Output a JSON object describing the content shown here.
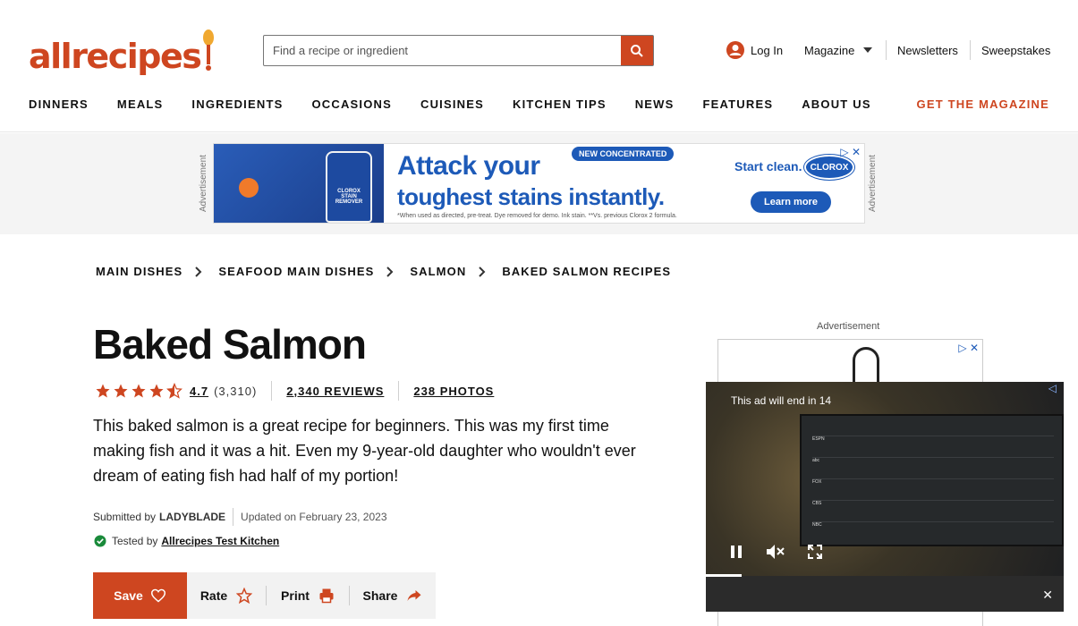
{
  "header": {
    "logo_text": "allrecipes",
    "search_placeholder": "Find a recipe or ingredient",
    "login_label": "Log In",
    "magazine_label": "Magazine",
    "newsletters_label": "Newsletters",
    "sweepstakes_label": "Sweepstakes",
    "brand_color": "#ce4620"
  },
  "nav": {
    "items": [
      "DINNERS",
      "MEALS",
      "INGREDIENTS",
      "OCCASIONS",
      "CUISINES",
      "KITCHEN TIPS",
      "NEWS",
      "FEATURES",
      "ABOUT US"
    ],
    "cta": "GET THE MAGAZINE"
  },
  "top_ad": {
    "label": "Advertisement",
    "headline_line1": "Attack your",
    "headline_line2": "toughest stains instantly.",
    "tag": "NEW CONCENTRATED",
    "start_clean": "Start clean.",
    "brand": "CLOROX",
    "bottle_text": "CLOROX STAIN REMOVER",
    "learn_more": "Learn more",
    "fine_print": "*When used as directed, pre-treat. Dye removed for demo. Ink stain. **Vs. previous Clorox 2 formula."
  },
  "breadcrumbs": [
    "MAIN DISHES",
    "SEAFOOD MAIN DISHES",
    "SALMON",
    "BAKED SALMON RECIPES"
  ],
  "recipe": {
    "title": "Baked Salmon",
    "rating_value": "4.7",
    "rating_count": "(3,310)",
    "rating_stars": 4.7,
    "reviews_link": "2,340 REVIEWS",
    "photos_link": "238 PHOTOS",
    "description": "This baked salmon is a great recipe for beginners. This was my first time making fish and it was a hit. Even my 9-year-old daughter who wouldn't ever dream of eating fish had half of my portion!",
    "submitted_by_label": "Submitted by",
    "author": "LADYBLADE",
    "updated": "Updated on February 23, 2023",
    "tested_by_label": "Tested by",
    "tested_by": "Allrecipes Test Kitchen"
  },
  "actions": {
    "save": "Save",
    "rate": "Rate",
    "print": "Print",
    "share": "Share"
  },
  "side_ad": {
    "label": "Advertisement"
  },
  "video": {
    "message": "This ad will end in 14",
    "tv_rows": [
      "ESPN",
      "abc",
      "FOX",
      "CBS",
      "NBC"
    ]
  }
}
